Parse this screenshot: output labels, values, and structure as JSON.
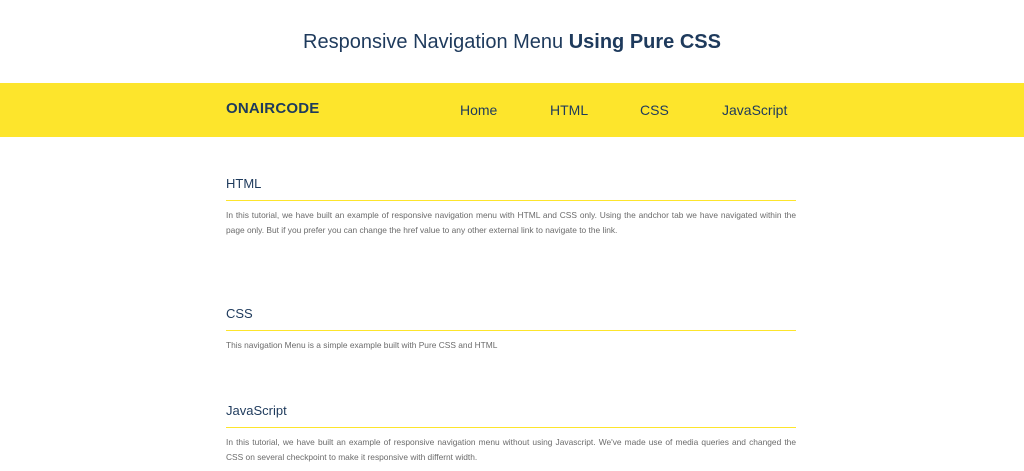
{
  "heading": {
    "normal_part": "Responsive Navigation Menu ",
    "bold_part": "Using Pure CSS"
  },
  "navbar": {
    "brand": "ONAIRCODE",
    "links": [
      "Home",
      "HTML",
      "CSS",
      "JavaScript"
    ]
  },
  "sections": [
    {
      "title": "HTML",
      "text": "In this tutorial, we have built an example of responsive navigation menu with HTML and CSS only. Using the andchor tab we have navigated within the page only. But if you prefer you can change the href value to any other external link to navigate to the link."
    },
    {
      "title": "CSS",
      "text": "This navigation Menu is a simple example built with Pure CSS and HTML"
    },
    {
      "title": "JavaScript",
      "text": "In this tutorial, we have built an example of responsive navigation menu without using Javascript. We've made use of media queries and changed the CSS on several checkpoint to make it responsive with differnt width."
    }
  ],
  "colors": {
    "accent": "#fde52c",
    "heading_text": "#1e3a5c",
    "body_text": "#6b6b6b"
  }
}
